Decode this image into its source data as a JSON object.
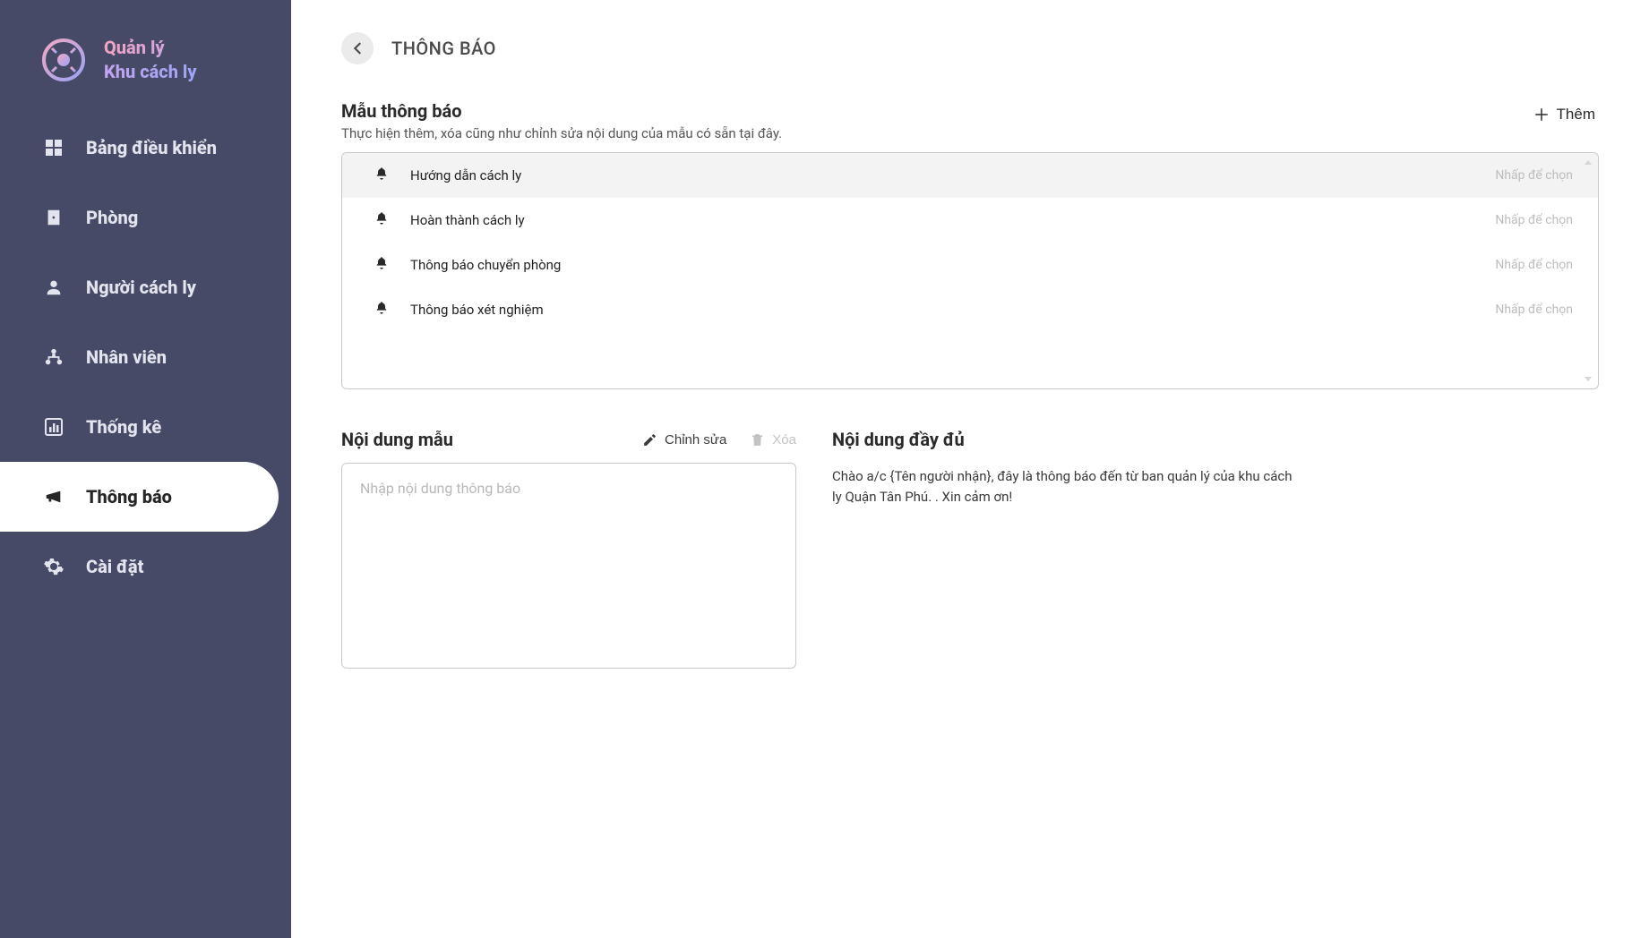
{
  "brand": {
    "line1": "Quản lý",
    "line2": "Khu cách ly"
  },
  "sidebar": {
    "items": [
      {
        "label": "Bảng điều khiển"
      },
      {
        "label": "Phòng"
      },
      {
        "label": "Người cách ly"
      },
      {
        "label": "Nhân viên"
      },
      {
        "label": "Thống kê"
      },
      {
        "label": "Thông báo"
      },
      {
        "label": "Cài đặt"
      }
    ]
  },
  "page": {
    "title": "THÔNG BÁO"
  },
  "templates": {
    "title": "Mẫu thông báo",
    "subtitle": "Thực hiện thêm, xóa cũng như chỉnh sửa nội dung của mẫu có sẵn tại đây.",
    "add_label": "Thêm",
    "hint": "Nhấp để chọn",
    "items": [
      {
        "label": "Hướng dẫn cách ly"
      },
      {
        "label": "Hoàn thành cách ly"
      },
      {
        "label": "Thông báo chuyển phòng"
      },
      {
        "label": "Thông báo xét nghiệm"
      }
    ]
  },
  "editor": {
    "title": "Nội dung mẫu",
    "edit_label": "Chỉnh sửa",
    "delete_label": "Xóa",
    "placeholder": "Nhập nội dung thông báo"
  },
  "preview": {
    "title": "Nội dung đầy đủ",
    "body": "Chào a/c {Tên người nhận}, đây là thông báo đến từ ban quản lý của khu cách ly Quận Tân Phú. . Xin cảm ơn!"
  }
}
